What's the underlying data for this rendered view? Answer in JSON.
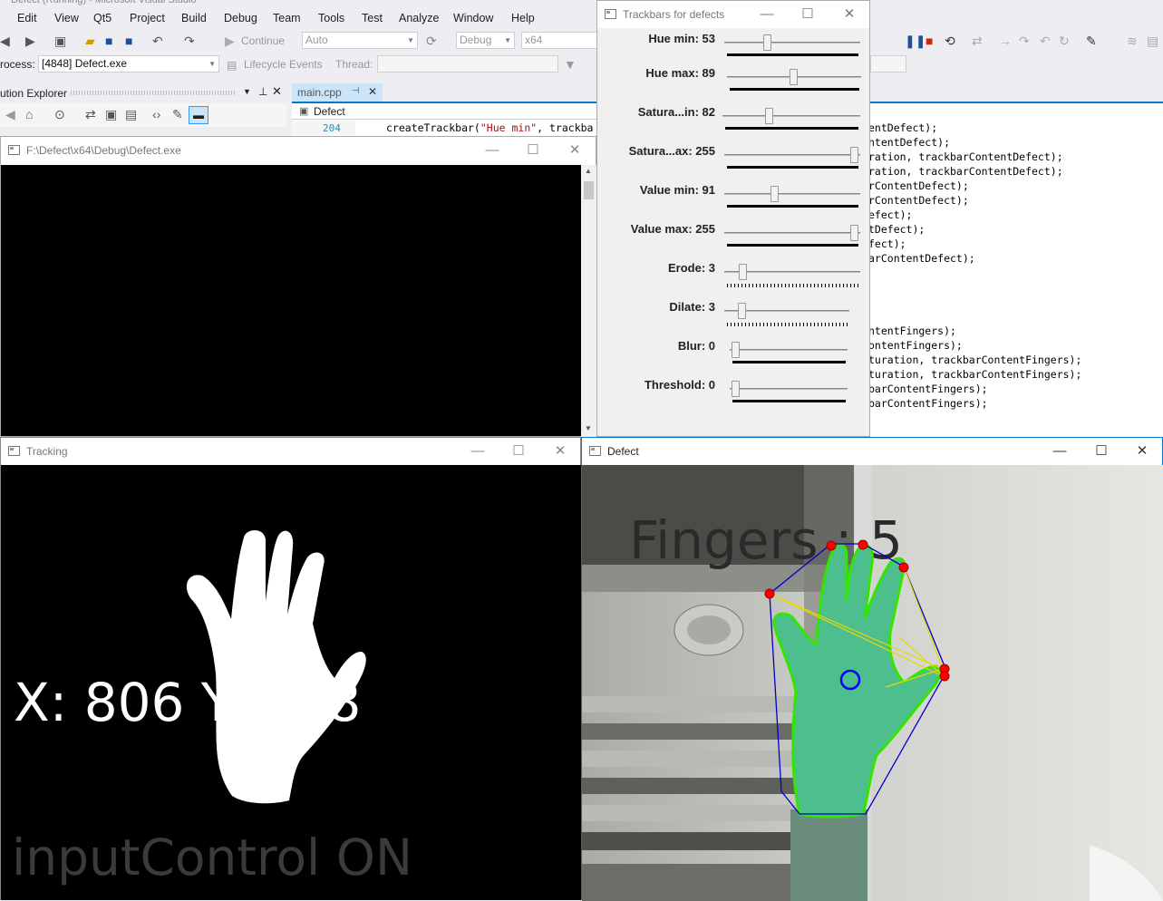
{
  "vs": {
    "title": "Defect (Running) - Microsoft Visual Studio",
    "menu": [
      "Edit",
      "View",
      "Qt5",
      "Project",
      "Build",
      "Debug",
      "Team",
      "Tools",
      "Test",
      "Analyze",
      "Window",
      "Help"
    ],
    "continue_label": "Continue",
    "config_combo": "Auto",
    "build_config": "Debug",
    "platform": "x64",
    "process_label": "rocess:",
    "process_value": "[4848] Defect.exe",
    "lifecycle_label": "Lifecycle Events",
    "thread_label": "Thread:",
    "solution_explorer_title": "ution Explorer",
    "editor_tab": "main.cpp",
    "editor_nav": "Defect",
    "line_number": "204",
    "code_line_204": "createTrackbar(\"Hue min\", trackba",
    "right_code_lines": [
      "entDefect);",
      "ntentDefect);",
      "ration, trackbarContentDefect);",
      "ration, trackbarContentDefect);",
      "rContentDefect);",
      "rContentDefect);",
      "efect);",
      "tDefect);",
      "fect);",
      "arContentDefect);",
      "",
      "",
      "",
      "",
      "ntentFingers);",
      "ontentFingers);",
      "turation, trackbarContentFingers);",
      "turation, trackbarContentFingers);",
      "barContentFingers);",
      "barContentFingers);"
    ]
  },
  "console_window": {
    "title": "F:\\Defect\\x64\\Debug\\Defect.exe"
  },
  "trackbars_window": {
    "title": "Trackbars for defects",
    "trackbars": [
      {
        "label": "Hue min: 53",
        "value": 53,
        "max": 179
      },
      {
        "label": "Hue max: 89",
        "value": 89,
        "max": 179
      },
      {
        "label": "Satura...in: 82",
        "value": 82,
        "max": 255
      },
      {
        "label": "Satura...ax: 255",
        "value": 255,
        "max": 255
      },
      {
        "label": "Value min: 91",
        "value": 91,
        "max": 255
      },
      {
        "label": "Value max: 255",
        "value": 255,
        "max": 255
      },
      {
        "label": "Erode: 3",
        "value": 3,
        "max": 30
      },
      {
        "label": "Dilate: 3",
        "value": 3,
        "max": 30
      },
      {
        "label": "Blur: 0",
        "value": 0,
        "max": 20
      },
      {
        "label": "Threshold: 0",
        "value": 0,
        "max": 255
      }
    ]
  },
  "tracking_window": {
    "title": "Tracking",
    "coords_text": "X: 806 Y: 478",
    "status_text": "inputControl ON"
  },
  "defect_window": {
    "title": "Defect",
    "fingers_text": "Fingers : 5"
  },
  "colors": {
    "vs_accent": "#007acc",
    "hull": "#0000c8",
    "contour": "#32e600",
    "defect_point": "#ff0000",
    "center": "#0000ff",
    "mask_fg": "#ffffff"
  }
}
